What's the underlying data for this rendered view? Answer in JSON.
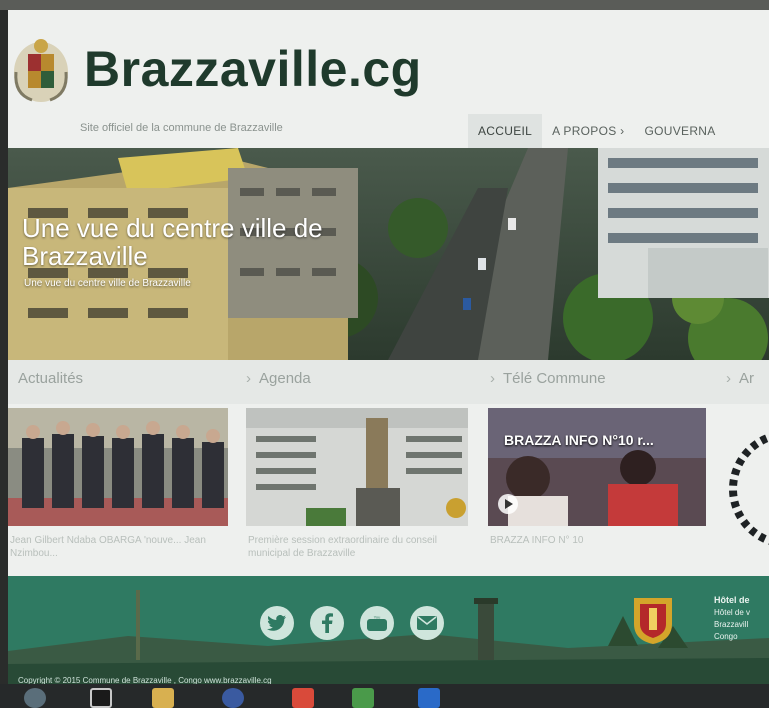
{
  "site": {
    "title": "Brazzaville.cg",
    "tagline": "Site officiel de la commune de Brazzaville"
  },
  "nav": {
    "items": [
      {
        "label": "ACCUEIL",
        "active": true
      },
      {
        "label": "A PROPOS ›",
        "active": false
      },
      {
        "label": "GOUVERNA",
        "active": false
      }
    ]
  },
  "hero": {
    "title": "Une vue du centre ville de Brazzaville",
    "subtitle": "Une vue du centre ville de Brazzaville"
  },
  "sections": [
    {
      "label": "Actualités",
      "chevron": ""
    },
    {
      "label": "Agenda",
      "chevron": "›"
    },
    {
      "label": "Télé Commune",
      "chevron": "›"
    },
    {
      "label": "Ar",
      "chevron": "›"
    }
  ],
  "cards": [
    {
      "caption": "Jean Gilbert Ndaba OBARGA 'nouve... Jean Nzimbou..."
    },
    {
      "caption": "Première session extraordinaire du conseil municipal de Brazzaville"
    },
    {
      "caption": "BRAZZA INFO N° 10",
      "video_title": "BRAZZA INFO N°10 r..."
    }
  ],
  "footer": {
    "copyright": "Copyright © 2015 Commune de Brazzaville , Congo     www.brazzaville.cg",
    "contact_title": "Hôtel de",
    "contact_lines": [
      "Hôtel de v",
      "Brazzavill",
      "Congo"
    ],
    "social_icons": [
      "twitter-icon",
      "facebook-icon",
      "youtube-icon",
      "mail-icon"
    ]
  },
  "colors": {
    "title": "#1f3a2c",
    "footer": "#2f7a62",
    "nav_text": "#5a625e"
  }
}
